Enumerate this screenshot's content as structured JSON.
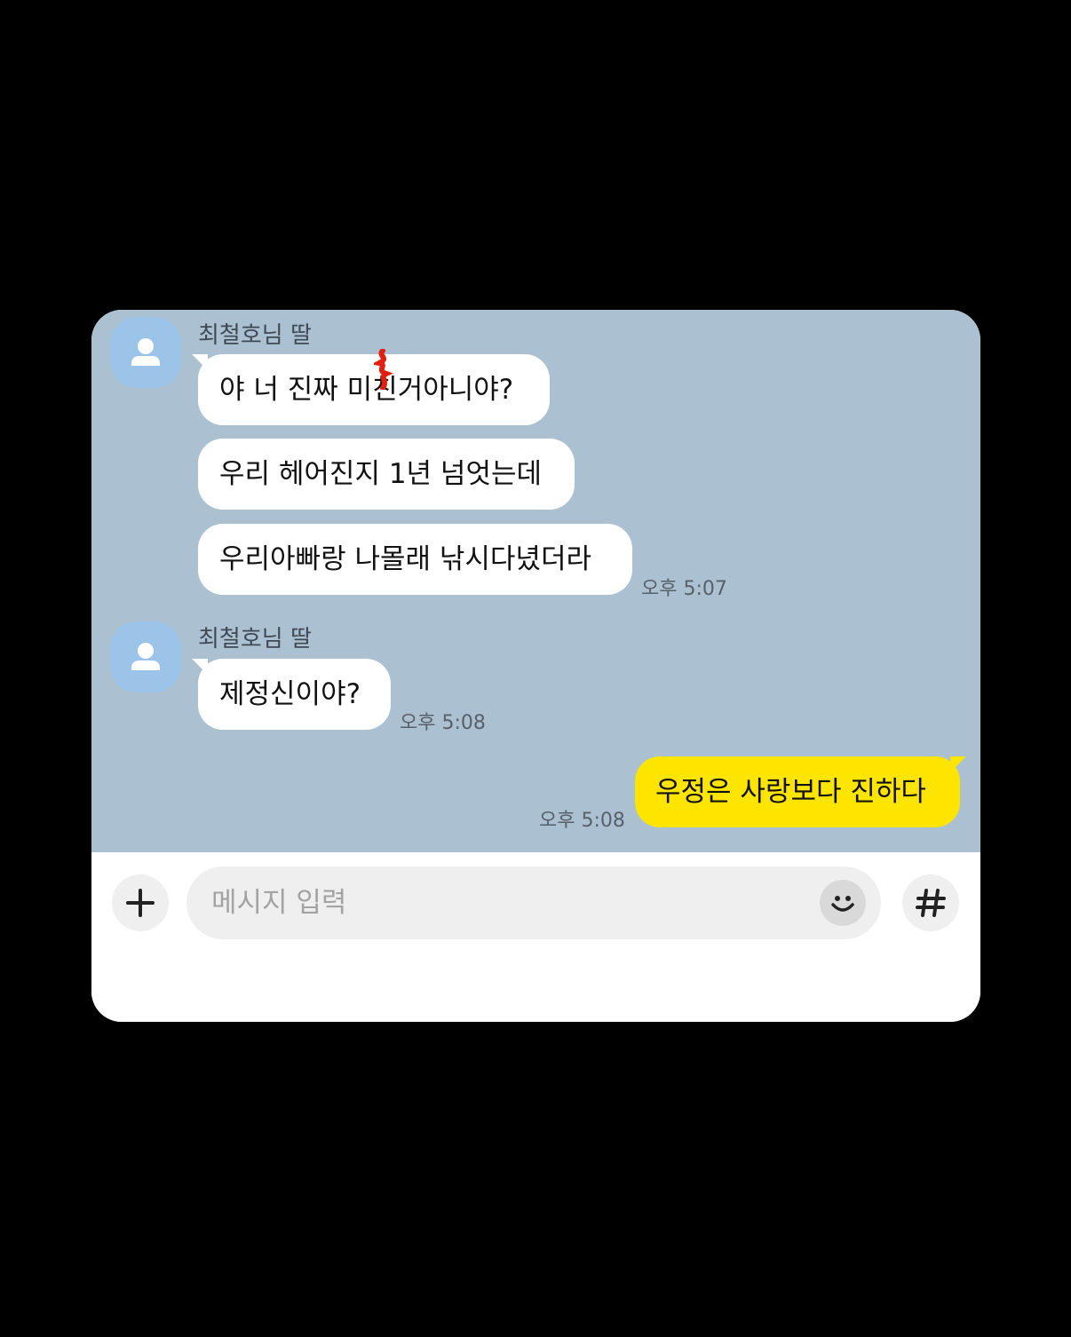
{
  "chat": {
    "groups": [
      {
        "sender": "최철호님 딸",
        "messages": [
          {
            "before": "야 너 진짜 미",
            "redacted": "친",
            "after": "거아니야?"
          },
          {
            "text": "우리 헤어진지 1년 넘엇는데"
          },
          {
            "text": "우리아빠랑 나몰래 낚시다녔더라"
          }
        ],
        "time": "오후 5:07"
      },
      {
        "sender": "최철호님 딸",
        "messages": [
          {
            "text": "제정신이야?"
          }
        ],
        "time": "오후 5:08"
      }
    ],
    "mine": {
      "text": "우정은 사랑보다 진하다",
      "time": "오후 5:08"
    }
  },
  "composer": {
    "placeholder": "메시지 입력",
    "add_icon": "plus-icon",
    "emoji_icon": "smile-emoticon-icon",
    "hashtag_icon": "hashtag-icon"
  },
  "colors": {
    "chat_background": "#abc1d1",
    "my_bubble": "#fee500",
    "other_bubble": "#ffffff",
    "avatar": "#9cc3e8",
    "redaction": "#e3200f"
  }
}
